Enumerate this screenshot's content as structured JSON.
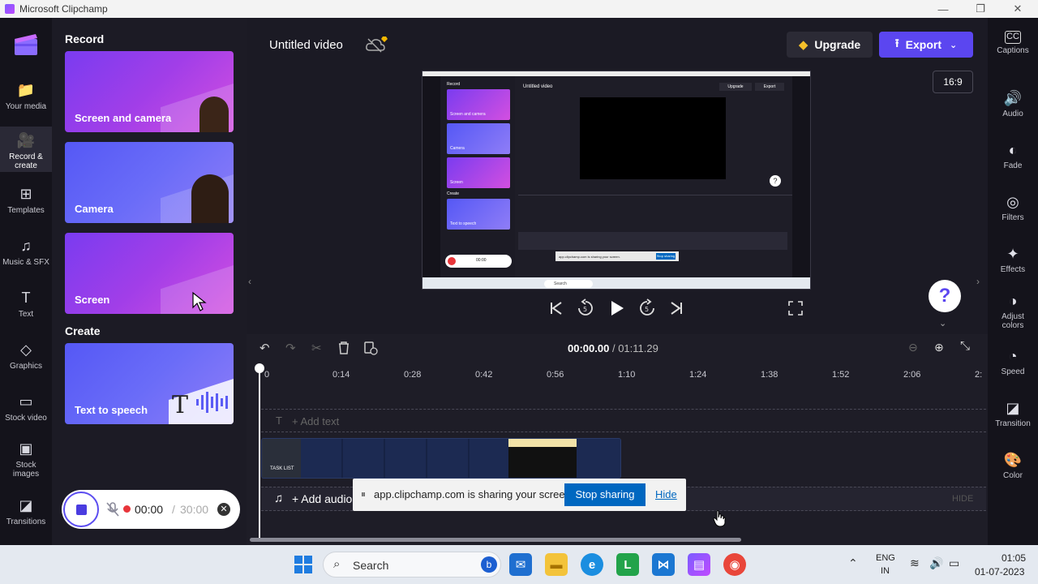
{
  "window": {
    "title": "Microsoft Clipchamp",
    "minimize": "—",
    "restore": "❐",
    "close": "✕"
  },
  "nav": {
    "items": [
      {
        "label": "Your media",
        "icon": "📁"
      },
      {
        "label": "Record &",
        "label2": "create",
        "icon": "🎥"
      },
      {
        "label": "Templates",
        "icon": "⊞"
      },
      {
        "label": "Music & SFX",
        "icon": "♫"
      },
      {
        "label": "Text",
        "icon": "T"
      },
      {
        "label": "Graphics",
        "icon": "◇"
      },
      {
        "label": "Stock video",
        "icon": "▭"
      },
      {
        "label": "Stock",
        "label2": "images",
        "icon": "▣"
      },
      {
        "label": "Transitions",
        "icon": "◪"
      }
    ]
  },
  "panel": {
    "record_heading": "Record",
    "create_heading": "Create",
    "cards": [
      "Screen and camera",
      "Camera",
      "Screen",
      "Text to speech"
    ]
  },
  "recorder": {
    "elapsed": "00:00",
    "separator": "/",
    "limit": "30:00"
  },
  "header": {
    "project_title": "Untitled video",
    "upgrade": "Upgrade",
    "export": "Export",
    "aspect_ratio": "16:9"
  },
  "player": {
    "current_time": "00:00.00",
    "separator": "/",
    "duration": "01:11.29"
  },
  "timeline": {
    "ticks": [
      "0",
      "0:14",
      "0:28",
      "0:42",
      "0:56",
      "1:10",
      "1:24",
      "1:38",
      "1:52",
      "2:06",
      "2:"
    ],
    "add_text": "+ Add text",
    "add_audio": "+ Add audio",
    "hide": "HIDE",
    "clip_label": "TASK LIST"
  },
  "sharing": {
    "message": "app.clipchamp.com is sharing your screen.",
    "stop": "Stop sharing",
    "hide": "Hide"
  },
  "rightbar": {
    "items": [
      {
        "label": "Captions",
        "icon": "CC"
      },
      {
        "label": "Audio",
        "icon": "🔊"
      },
      {
        "label": "Fade",
        "icon": "◐"
      },
      {
        "label": "Filters",
        "icon": "◎"
      },
      {
        "label": "Effects",
        "icon": "✦"
      },
      {
        "label": "Adjust",
        "label2": "colors",
        "icon": "◑"
      },
      {
        "label": "Speed",
        "icon": "◔"
      },
      {
        "label": "Transition",
        "icon": "◪"
      },
      {
        "label": "Color",
        "icon": "🎨"
      }
    ]
  },
  "help": "?",
  "taskbar": {
    "search": "Search",
    "lang1": "ENG",
    "lang2": "IN",
    "time": "01:05",
    "date": "01-07-2023"
  },
  "mini_preview": {
    "record": "Record",
    "create": "Create",
    "untitled": "Untitled video",
    "upgrade": "Upgrade",
    "export": "Export",
    "cards": [
      "Screen and camera",
      "Camera",
      "Screen",
      "Text to speech"
    ],
    "share_msg": "app.clipchamp.com is sharing your screen.",
    "stop": "Stop sharing",
    "hide": "Hide",
    "time": "00:00",
    "search": "Search"
  },
  "colors": {
    "accent": "#5b46f0",
    "background": "#1b1a24",
    "share_button": "#0067c0"
  }
}
